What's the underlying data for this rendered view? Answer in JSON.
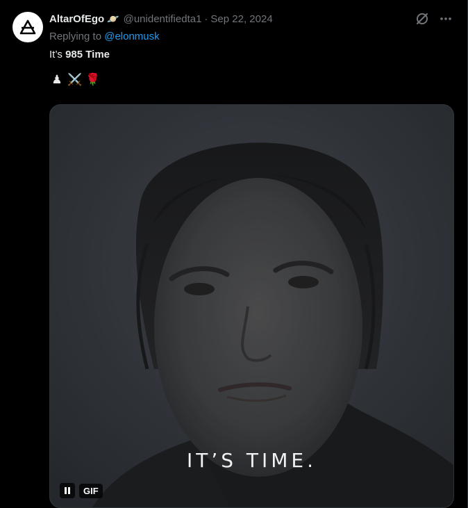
{
  "tweet": {
    "display_name": "AltarOfEgo",
    "name_emoji": "🪐",
    "handle": "@unidentifiedta1",
    "separator": "·",
    "date": "Sep 22, 2024",
    "reply_prefix": "Replying to",
    "reply_mention": "@elonmusk",
    "text_prefix": "It’s",
    "text_bold": "985 Time",
    "emojis": [
      "♟",
      "⚔️",
      "🌹"
    ]
  },
  "media": {
    "caption": "IT’S TIME.",
    "gif_label": "GIF",
    "pause_icon": "pause-icon"
  },
  "icons": {
    "avatar": "alchemy-triangle-icon",
    "grok": "grok-icon",
    "more": "more-icon"
  },
  "colors": {
    "background": "#000000",
    "text": "#e7e9ea",
    "muted": "#71767b",
    "link": "#1d9bf0"
  }
}
